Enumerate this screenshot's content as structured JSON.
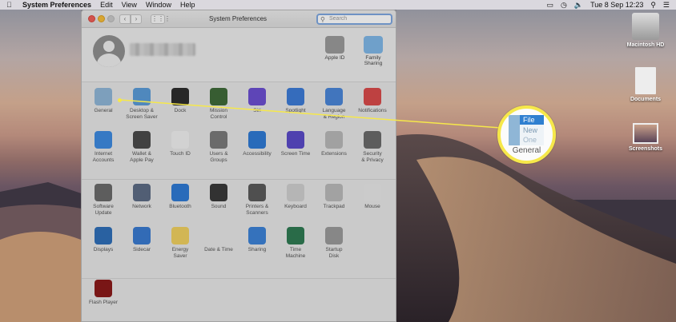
{
  "menubar": {
    "app_name": "System Preferences",
    "menus": [
      "Edit",
      "View",
      "Window",
      "Help"
    ],
    "datetime": "Tue 8 Sep  12:23"
  },
  "window": {
    "title": "System Preferences",
    "search_placeholder": "Search"
  },
  "account": {
    "items": [
      {
        "label": "Apple ID",
        "icon": "apple-id-icon"
      },
      {
        "label": "Family\nSharing",
        "icon": "family-sharing-icon"
      }
    ]
  },
  "prefs": {
    "row1": [
      "General",
      "Desktop &\nScreen Saver",
      "Dock",
      "Mission\nControl",
      "Siri",
      "Spotlight",
      "Language\n& Region",
      "Notifications"
    ],
    "row2": [
      "Internet\nAccounts",
      "Wallet &\nApple Pay",
      "Touch ID",
      "Users &\nGroups",
      "Accessibility",
      "Screen Time",
      "Extensions",
      "Security\n& Privacy"
    ],
    "row3": [
      "Software\nUpdate",
      "Network",
      "Bluetooth",
      "Sound",
      "Printers &\nScanners",
      "Keyboard",
      "Trackpad",
      "Mouse"
    ],
    "row4": [
      "Displays",
      "Sidecar",
      "Energy\nSaver",
      "Date & Time",
      "Sharing",
      "Time\nMachine",
      "Startup\nDisk"
    ],
    "other": [
      "Flash Player"
    ]
  },
  "desktop_icons": [
    "Macintosh HD",
    "Documents",
    "Screenshots"
  ],
  "callout": {
    "caption": "General",
    "icon_text": [
      "File",
      "New",
      "One"
    ],
    "highlight_color": "#f6e84a"
  }
}
